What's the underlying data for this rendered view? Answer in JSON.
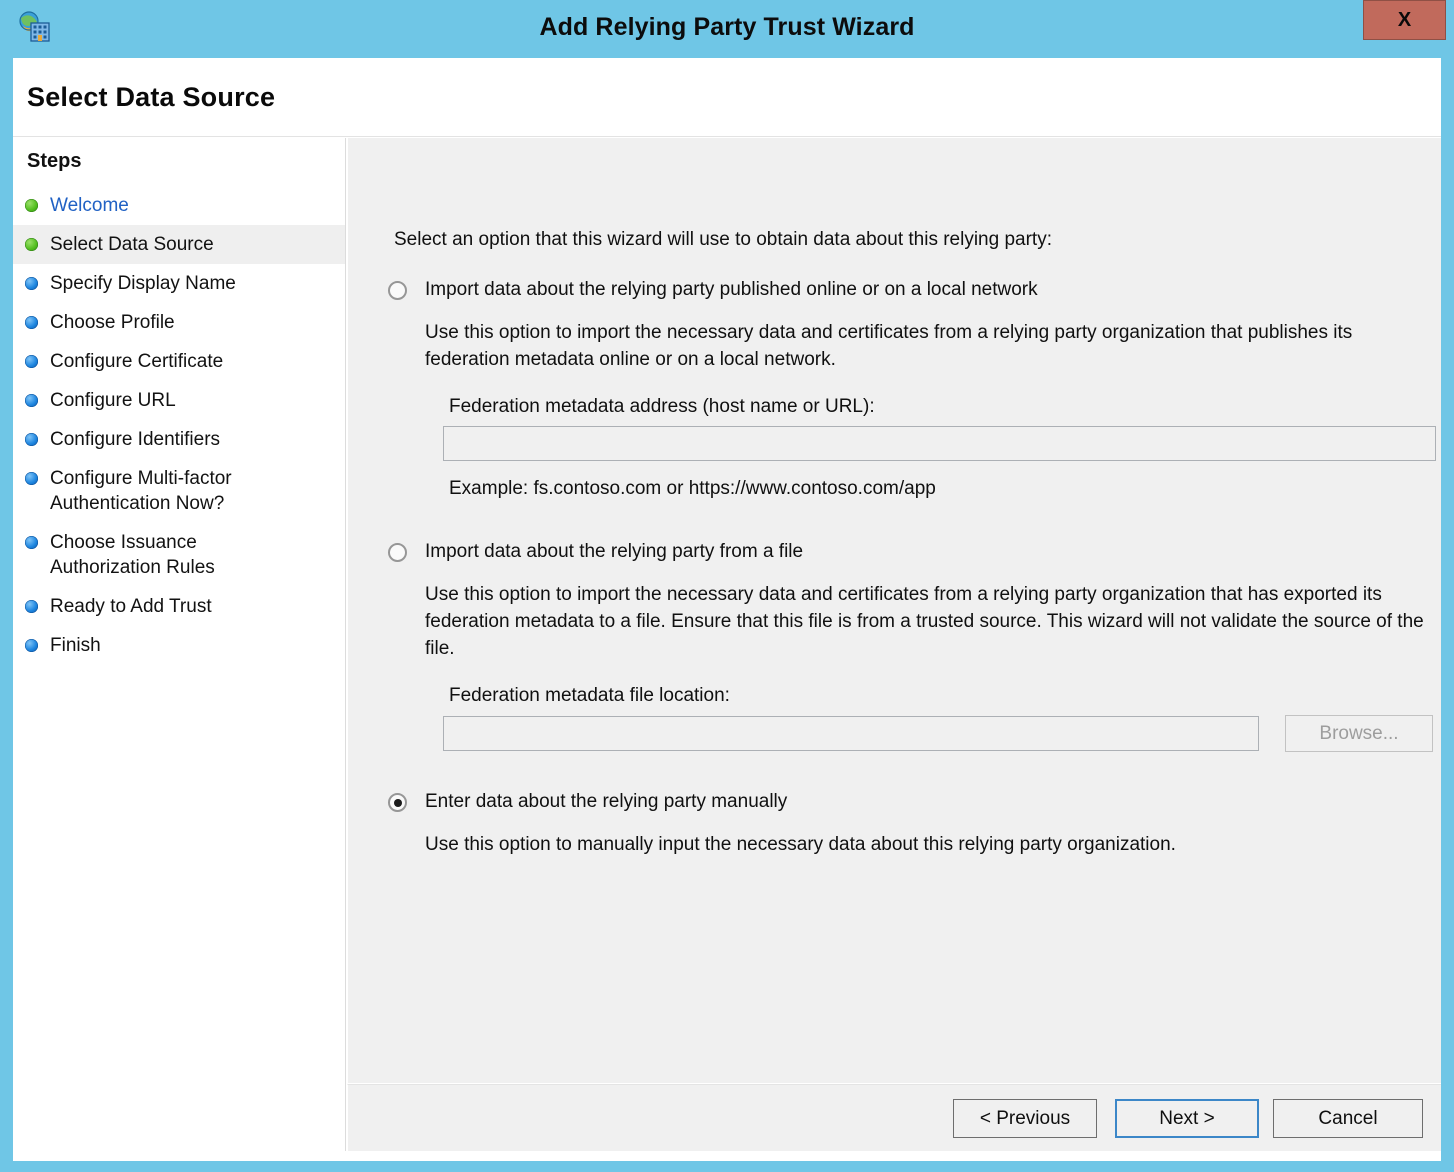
{
  "window": {
    "title": "Add Relying Party Trust Wizard",
    "icon": "relying-party-trust-icon",
    "close_label": "X",
    "chrome_color": "#6FC6E6",
    "close_color": "#C16A5C"
  },
  "page": {
    "title": "Select Data Source"
  },
  "sidebar": {
    "heading": "Steps",
    "items": [
      {
        "label": "Welcome",
        "state": "done",
        "bullet": "green",
        "current": false,
        "link": true
      },
      {
        "label": "Select Data Source",
        "state": "current",
        "bullet": "green",
        "current": true,
        "link": false
      },
      {
        "label": "Specify Display Name",
        "state": "pending",
        "bullet": "blue",
        "current": false,
        "link": false
      },
      {
        "label": "Choose Profile",
        "state": "pending",
        "bullet": "blue",
        "current": false,
        "link": false
      },
      {
        "label": "Configure Certificate",
        "state": "pending",
        "bullet": "blue",
        "current": false,
        "link": false
      },
      {
        "label": "Configure URL",
        "state": "pending",
        "bullet": "blue",
        "current": false,
        "link": false
      },
      {
        "label": "Configure Identifiers",
        "state": "pending",
        "bullet": "blue",
        "current": false,
        "link": false
      },
      {
        "label": "Configure Multi-factor\nAuthentication Now?",
        "state": "pending",
        "bullet": "blue",
        "current": false,
        "link": false
      },
      {
        "label": "Choose Issuance\nAuthorization Rules",
        "state": "pending",
        "bullet": "blue",
        "current": false,
        "link": false
      },
      {
        "label": "Ready to Add Trust",
        "state": "pending",
        "bullet": "blue",
        "current": false,
        "link": false
      },
      {
        "label": "Finish",
        "state": "pending",
        "bullet": "blue",
        "current": false,
        "link": false
      }
    ]
  },
  "main": {
    "intro": "Select an option that this wizard will use to obtain data about this relying party:",
    "options": [
      {
        "id": "import-online",
        "label": "Import data about the relying party published online or on a local network",
        "selected": false,
        "description": "Use this option to import the necessary data and certificates from a relying party organization that publishes its federation metadata online or on a local network.",
        "field_label": "Federation metadata address (host name or URL):",
        "field_value": "",
        "field_placeholder": "",
        "example": "Example: fs.contoso.com or https://www.contoso.com/app"
      },
      {
        "id": "import-file",
        "label": "Import data about the relying party from a file",
        "selected": false,
        "description": "Use this option to import the necessary data and certificates from a relying party organization that has exported its federation metadata to a file. Ensure that this file is from a trusted source.  This wizard will not validate the source of the file.",
        "field_label": "Federation metadata file location:",
        "field_value": "",
        "field_placeholder": "",
        "browse_label": "Browse..."
      },
      {
        "id": "manual-entry",
        "label": "Enter data about the relying party manually",
        "selected": true,
        "description": "Use this option to manually input the necessary data about this relying party organization."
      }
    ]
  },
  "footer": {
    "previous_label": "< Previous",
    "next_label": "Next >",
    "cancel_label": "Cancel",
    "focused_button": "Next >"
  }
}
